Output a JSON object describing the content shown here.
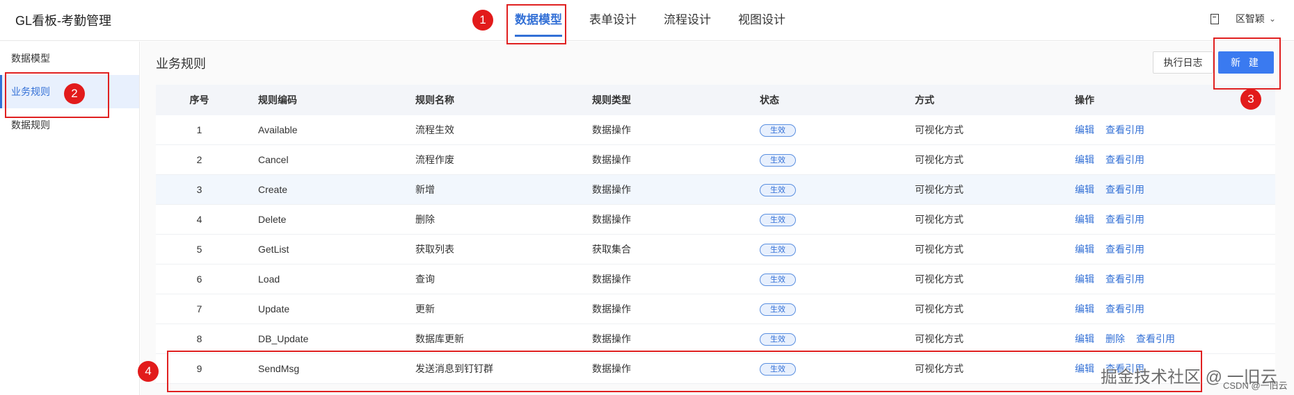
{
  "app": {
    "title": "GL看板-考勤管理"
  },
  "top_tabs": [
    {
      "label": "数据模型",
      "active": true
    },
    {
      "label": "表单设计",
      "active": false
    },
    {
      "label": "流程设计",
      "active": false
    },
    {
      "label": "视图设计",
      "active": false
    }
  ],
  "user": {
    "name": "区智颖"
  },
  "sidebar": {
    "items": [
      {
        "label": "数据模型",
        "active": false
      },
      {
        "label": "业务规则",
        "active": true
      },
      {
        "label": "数据规则",
        "active": false
      }
    ]
  },
  "page": {
    "title": "业务规则"
  },
  "buttons": {
    "log": "执行日志",
    "new": "新 建"
  },
  "table": {
    "headers": [
      "序号",
      "规则编码",
      "规则名称",
      "规则类型",
      "状态",
      "方式",
      "操作"
    ],
    "rows": [
      {
        "no": "1",
        "code": "Available",
        "name": "流程生效",
        "type": "数据操作",
        "status": "生效",
        "mode": "可视化方式",
        "actions": [
          "编辑",
          "查看引用"
        ]
      },
      {
        "no": "2",
        "code": "Cancel",
        "name": "流程作废",
        "type": "数据操作",
        "status": "生效",
        "mode": "可视化方式",
        "actions": [
          "编辑",
          "查看引用"
        ]
      },
      {
        "no": "3",
        "code": "Create",
        "name": "新增",
        "type": "数据操作",
        "status": "生效",
        "mode": "可视化方式",
        "actions": [
          "编辑",
          "查看引用"
        ]
      },
      {
        "no": "4",
        "code": "Delete",
        "name": "删除",
        "type": "数据操作",
        "status": "生效",
        "mode": "可视化方式",
        "actions": [
          "编辑",
          "查看引用"
        ]
      },
      {
        "no": "5",
        "code": "GetList",
        "name": "获取列表",
        "type": "获取集合",
        "status": "生效",
        "mode": "可视化方式",
        "actions": [
          "编辑",
          "查看引用"
        ]
      },
      {
        "no": "6",
        "code": "Load",
        "name": "查询",
        "type": "数据操作",
        "status": "生效",
        "mode": "可视化方式",
        "actions": [
          "编辑",
          "查看引用"
        ]
      },
      {
        "no": "7",
        "code": "Update",
        "name": "更新",
        "type": "数据操作",
        "status": "生效",
        "mode": "可视化方式",
        "actions": [
          "编辑",
          "查看引用"
        ]
      },
      {
        "no": "8",
        "code": "DB_Update",
        "name": "数据库更新",
        "type": "数据操作",
        "status": "生效",
        "mode": "可视化方式",
        "actions": [
          "编辑",
          "删除",
          "查看引用"
        ]
      },
      {
        "no": "9",
        "code": "SendMsg",
        "name": "发送消息到钉钉群",
        "type": "数据操作",
        "status": "生效",
        "mode": "可视化方式",
        "actions": [
          "编辑",
          "查看引用"
        ]
      }
    ]
  },
  "annotations": [
    "1",
    "2",
    "3",
    "4"
  ],
  "watermark": {
    "main": "掘金技术社区 @ 一旧云",
    "sub": "CSDN @一旧云"
  },
  "colors": {
    "accent": "#3370d6",
    "primary_button": "#3a7af0",
    "annotation": "#e02020"
  }
}
